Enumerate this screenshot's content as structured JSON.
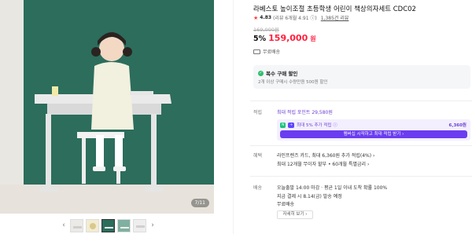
{
  "gallery": {
    "counter": "7/11",
    "thumbs": [
      "thumb-1",
      "thumb-2",
      "thumb-3",
      "thumb-4",
      "thumb-5"
    ],
    "active_thumb_index": 2,
    "prev_icon": "chevron-left-icon",
    "next_icon": "chevron-right-icon"
  },
  "product": {
    "title": "라베스토 높이조절 초등학생 어린이 책상의자세트 CDC02",
    "rating_score": "4.83",
    "rating_detail": "(리뷰 6개월 4.91 ⓘ)",
    "review_count": "1,385건 리뷰",
    "original_price": "169,000원",
    "discount": "5%",
    "price": "159,000",
    "currency": "원",
    "shipping_badge": "무료배송"
  },
  "coupon": {
    "title": "복수 구매 할인",
    "subtitle": "2개 이상 구매시 수량만큼 500원 할인"
  },
  "points": {
    "label": "적립",
    "max_text": "최대 적립 포인트 29,580원",
    "badge1": "N",
    "badge2": "+",
    "extra_text": "최대 5% 추가 적립 ⓘ",
    "extra_amount": "6,360원",
    "button_label": "멤버십 시작하고 최대 적립 받기 ›"
  },
  "benefits": {
    "label": "혜택",
    "line1": "라인프렌즈 카드, 최대 6,360원 추가 적립(4%) ›",
    "line2": "최대 12개월 무이자 할부 • 60개월 특별금리 ›"
  },
  "delivery": {
    "label": "배송",
    "line1": "오늘출발 14:00 마감 · 평균 1일 이내 도착 확률 100%",
    "line2": "지금 결제 시 8.14(금) 발송 예정",
    "line3": "무료배송",
    "more_label": "자세히 보기 ›"
  },
  "colors": {
    "price_red": "#ff1f3d",
    "purple": "#6a3df0",
    "green": "#2fbf71",
    "photo_bg": "#2a6a5a"
  }
}
